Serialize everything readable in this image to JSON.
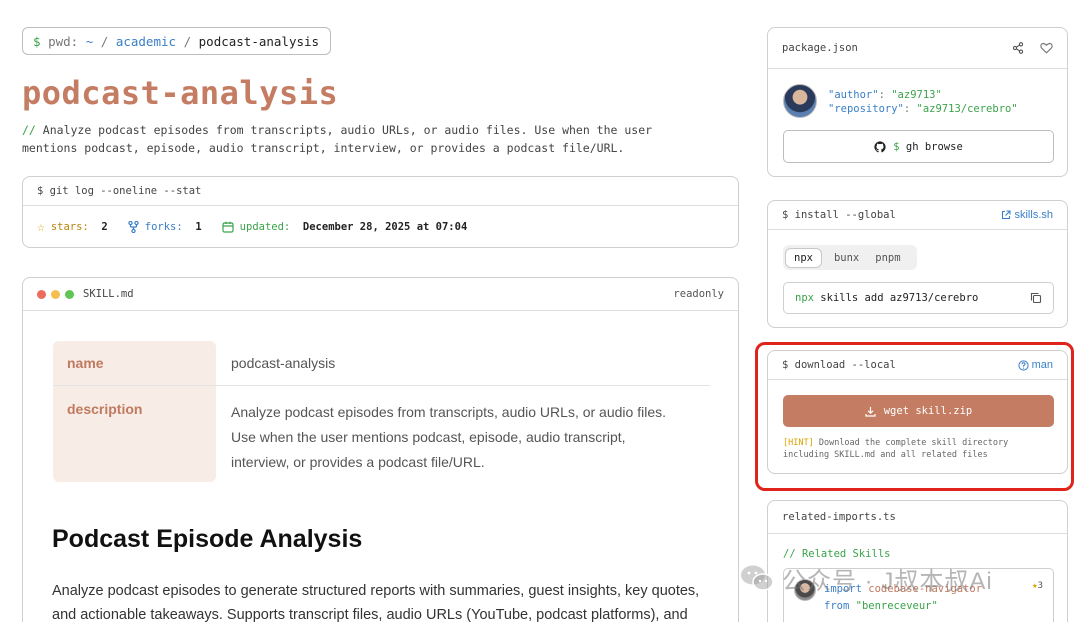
{
  "breadcrumb": {
    "prompt": "$",
    "pwd": "pwd:",
    "home": "~",
    "sep": "/",
    "parent": "academic",
    "current": "podcast-analysis"
  },
  "title": "podcast-analysis",
  "description": {
    "prefix": "//",
    "line1": "Analyze podcast episodes from transcripts, audio URLs, or audio files. Use when the user",
    "line2": "mentions podcast, episode, audio transcript, interview, or provides a podcast file/URL."
  },
  "git_log": {
    "command": "$ git log --oneline --stat",
    "stars_label": "stars:",
    "stars_value": "2",
    "forks_label": "forks:",
    "forks_value": "1",
    "updated_label": "updated:",
    "updated_value": "December 28, 2025 at 07:04"
  },
  "skill_file": {
    "filename": "SKILL.md",
    "mode": "readonly",
    "table": [
      {
        "key": "name",
        "value": "podcast-analysis"
      },
      {
        "key": "description",
        "value_lines": [
          "Analyze podcast episodes from transcripts, audio URLs, or audio files.",
          "Use when the user mentions podcast, episode, audio transcript,",
          "interview, or provides a podcast file/URL."
        ]
      }
    ],
    "heading": "Podcast Episode Analysis",
    "body_line1": "Analyze podcast episodes to generate structured reports with summaries, guest insights, key quotes,",
    "body_line2": "and actionable takeaways. Supports transcript files, audio URLs (YouTube, podcast platforms), and"
  },
  "package_json": {
    "title": "package.json",
    "author_key": "\"author\"",
    "author_value": "\"az9713\"",
    "repo_key": "\"repository\"",
    "repo_value": "\"az9713/cerebro\"",
    "browse_button": {
      "prompt": "$",
      "label": "gh browse"
    }
  },
  "install": {
    "title": "$ install --global",
    "link": "skills.sh",
    "tabs": [
      "npx",
      "bunx",
      "pnpm"
    ],
    "active_tab": "npx",
    "command_prefix": "npx",
    "command": "skills add az9713/cerebro"
  },
  "download": {
    "title": "$ download --local",
    "man_link": "man",
    "button": "wget skill.zip",
    "hint_tag": "[HINT]",
    "hint_line1": "Download the complete skill directory",
    "hint_line2": "including SKILL.md and all related files"
  },
  "related": {
    "title": "related-imports.ts",
    "comment": "// Related Skills",
    "import_kw": "import",
    "import_name": "codebase-navigator",
    "from_kw": "from",
    "from_value": "\"benreceveur\"",
    "badge": "3"
  },
  "watermark": "公众号 · J叔本叔Ai",
  "colors": {
    "accent": "#c47d63",
    "highlight_border": "#e0241b",
    "green": "#3aa34a",
    "blue": "#3a7fc8"
  }
}
